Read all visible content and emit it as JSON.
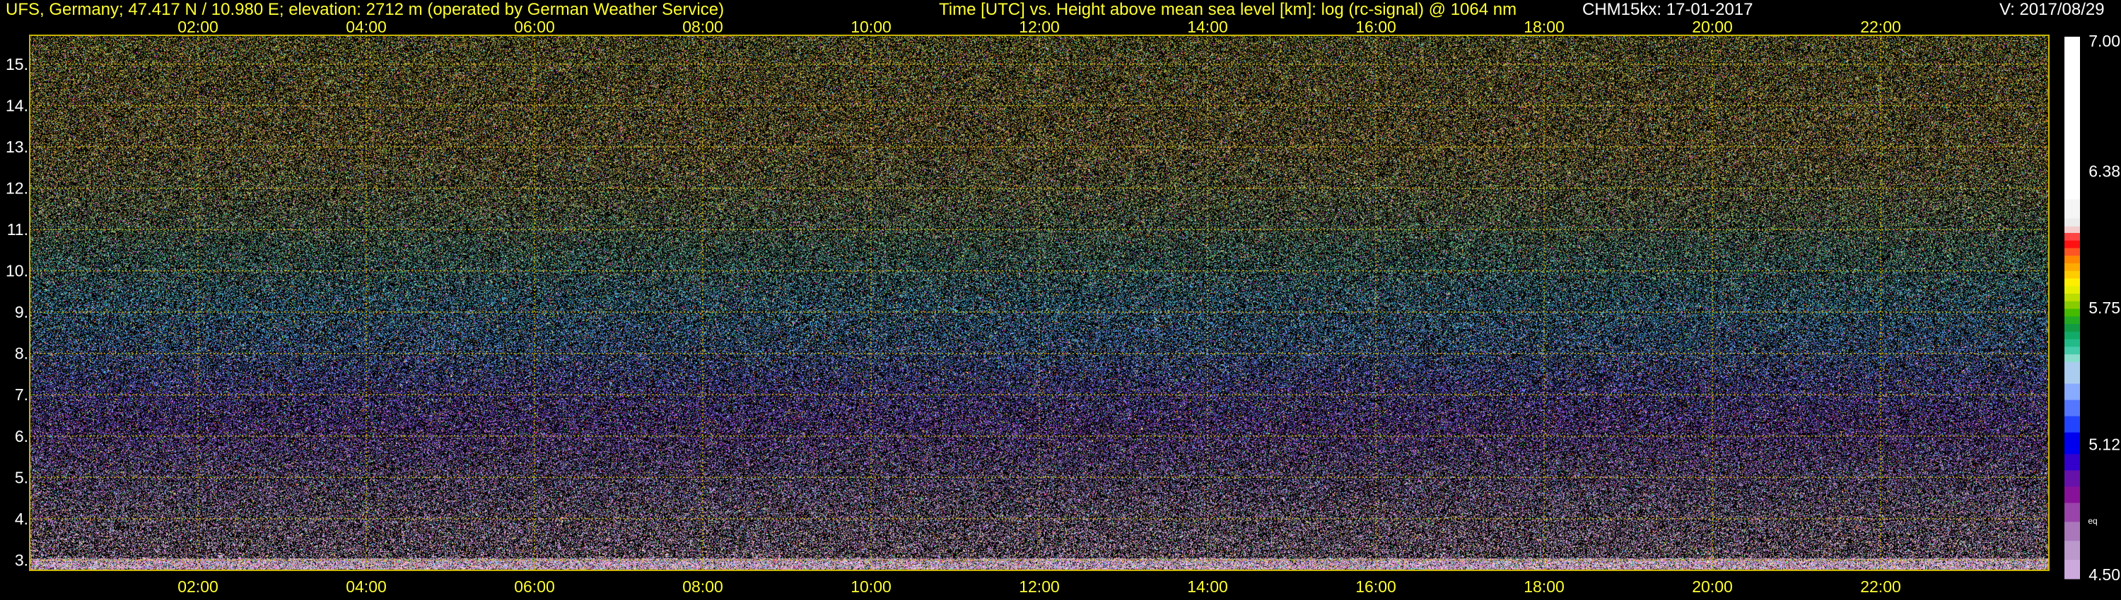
{
  "header": {
    "station": "UFS, Germany; 47.417 N / 10.980 E; elevation: 2712 m  (operated by German Weather Service)",
    "title": "Time [UTC] vs. Height above mean sea level [km]: log (rc-signal) @ 1064 nm",
    "instrument_date": "CHM15kx: 17-01-2017",
    "version": "V: 2017/08/29"
  },
  "colors": {
    "text_yellow": "#ffff33",
    "text_white": "#ffffff",
    "frame": "#c8b400",
    "grid": "#b8a800",
    "background": "#000000"
  },
  "chart_data": {
    "type": "heatmap",
    "title": "Time [UTC] vs. Height above mean sea level [km]: log (rc-signal) @ 1064 nm",
    "xlabel": "Time [UTC]",
    "ylabel": "Height above mean sea level [km]",
    "x_ticks": [
      "02:00",
      "04:00",
      "06:00",
      "08:00",
      "10:00",
      "12:00",
      "14:00",
      "16:00",
      "18:00",
      "20:00",
      "22:00"
    ],
    "x_tick_hours": [
      2,
      4,
      6,
      8,
      10,
      12,
      14,
      16,
      18,
      20,
      22
    ],
    "xlim_hours": [
      0,
      24
    ],
    "y_ticks": [
      "3.",
      "4.",
      "5.",
      "6.",
      "7.",
      "8.",
      "9.",
      "10.",
      "11.",
      "12.",
      "13.",
      "14.",
      "15."
    ],
    "y_tick_values": [
      3,
      4,
      5,
      6,
      7,
      8,
      9,
      10,
      11,
      12,
      13,
      14,
      15
    ],
    "ylim_km": [
      2.75,
      15.7
    ],
    "grid": true,
    "colorbar": {
      "ticks": [
        "7.00",
        "6.38",
        "5.75",
        "5.12",
        "4.50"
      ],
      "tick_values": [
        7.0,
        6.38,
        5.75,
        5.12,
        4.5
      ],
      "range": [
        4.5,
        7.0
      ],
      "small_label": "eq"
    },
    "field_description_by_height": [
      {
        "km": 3.0,
        "dominant": "light pink / white noise"
      },
      {
        "km": 5.0,
        "dominant": "lavender / purple"
      },
      {
        "km": 7.0,
        "dominant": "purple"
      },
      {
        "km": 9.0,
        "dominant": "blue / teal"
      },
      {
        "km": 11.0,
        "dominant": "green / teal"
      },
      {
        "km": 13.5,
        "dominant": "olive / orange"
      },
      {
        "km": 15.5,
        "dominant": "olive / yellow-green"
      }
    ]
  }
}
